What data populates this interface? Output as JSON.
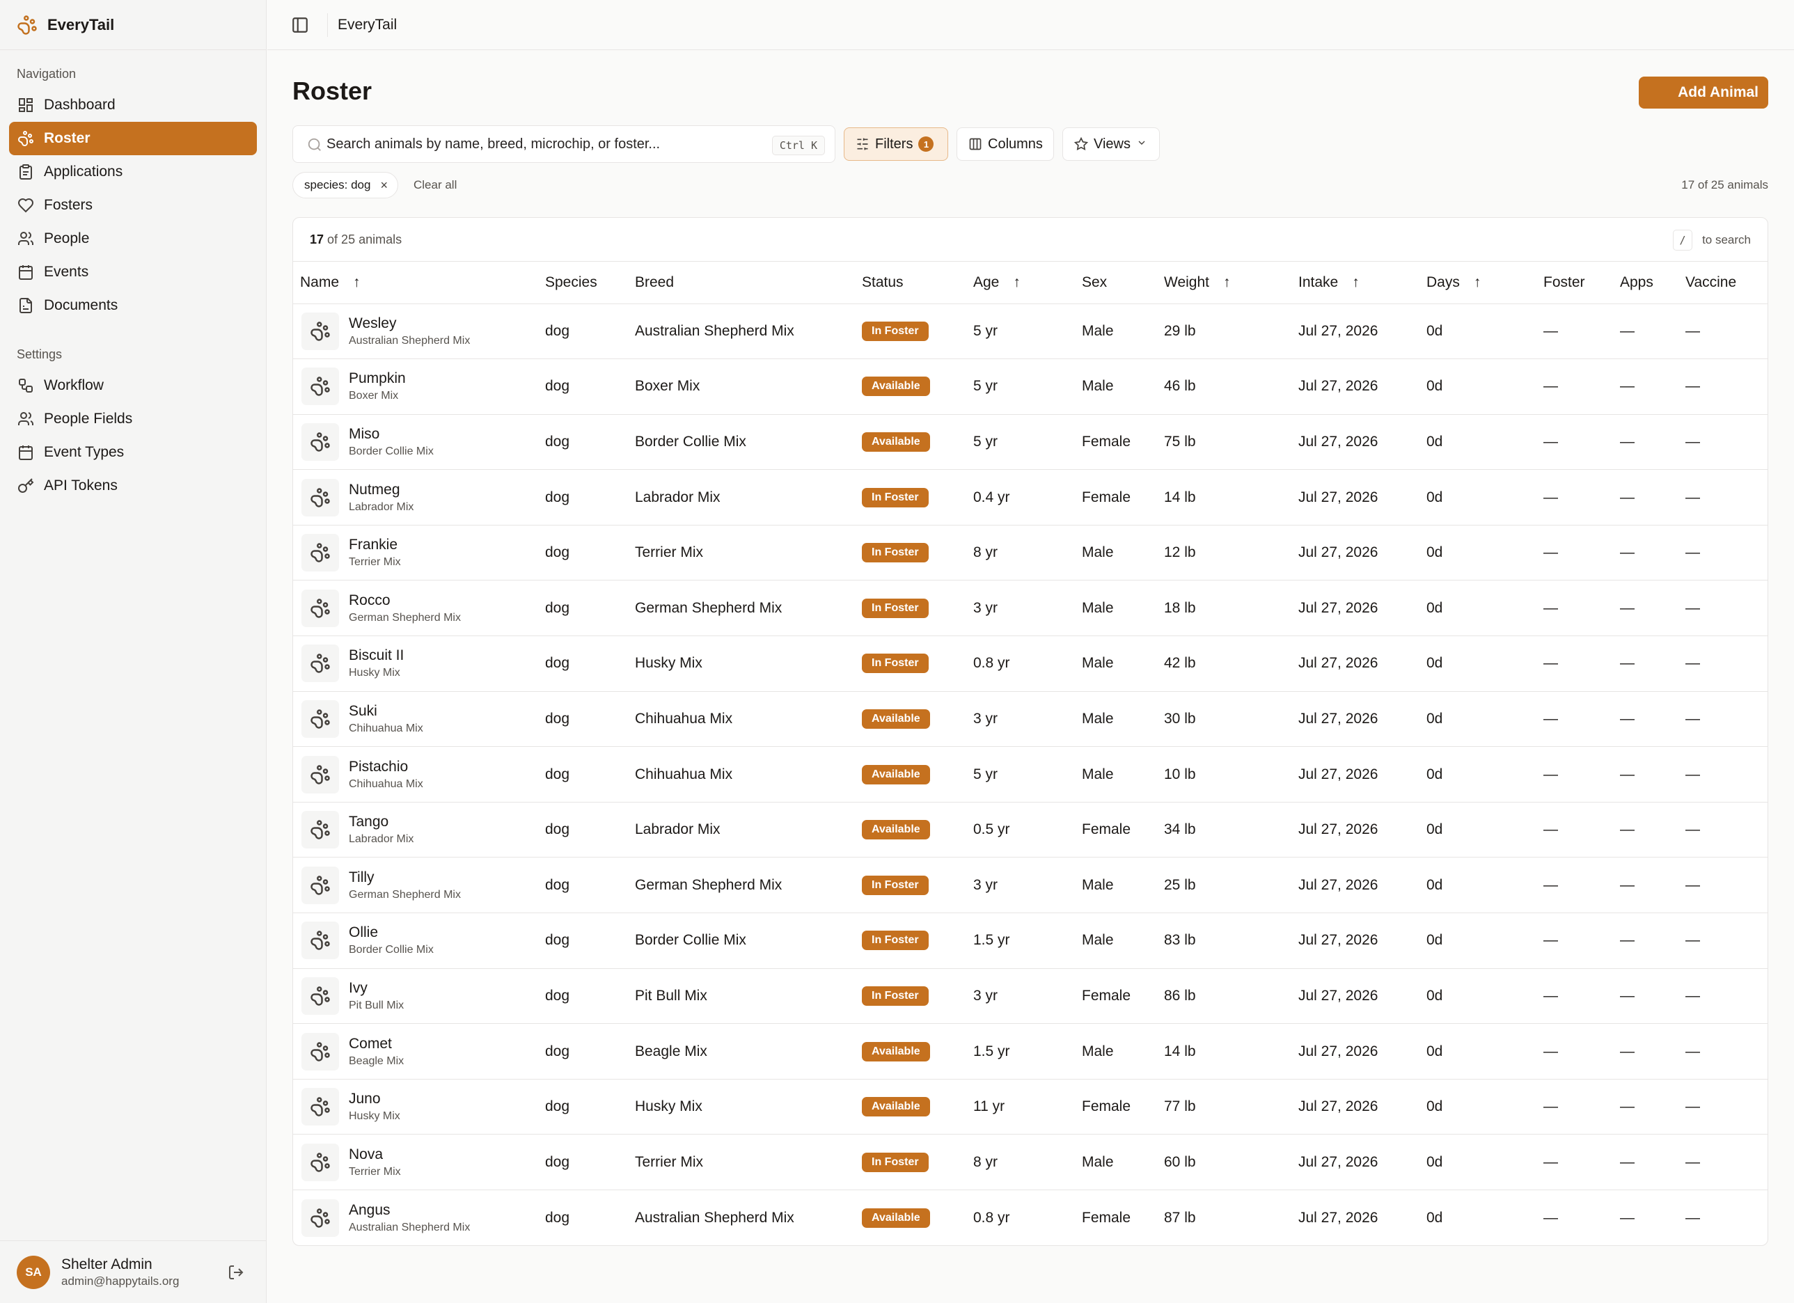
{
  "app": {
    "name": "EveryTail",
    "topbar_title": "EveryTail"
  },
  "sidebar": {
    "nav_title": "Navigation",
    "nav_items": [
      {
        "label": "Dashboard",
        "icon": "dashboard-icon"
      },
      {
        "label": "Roster",
        "icon": "paw-icon",
        "active": true
      },
      {
        "label": "Applications",
        "icon": "clipboard-icon"
      },
      {
        "label": "Fosters",
        "icon": "heart-hand-icon"
      },
      {
        "label": "People",
        "icon": "users-icon"
      },
      {
        "label": "Events",
        "icon": "calendar-icon"
      },
      {
        "label": "Documents",
        "icon": "document-icon"
      }
    ],
    "settings_title": "Settings",
    "settings_items": [
      {
        "label": "Workflow",
        "icon": "workflow-icon"
      },
      {
        "label": "People Fields",
        "icon": "users-icon"
      },
      {
        "label": "Event Types",
        "icon": "calendar-icon"
      },
      {
        "label": "API Tokens",
        "icon": "key-icon"
      }
    ],
    "user": {
      "initials": "SA",
      "name": "Shelter Admin",
      "email": "admin@happytails.org"
    }
  },
  "page": {
    "title": "Roster",
    "add_button": "Add Animal",
    "search_placeholder": "Search animals by name, breed, microchip, or foster...",
    "search_shortcut": "Ctrl K",
    "filters_label": "Filters",
    "filters_count": "1",
    "columns_label": "Columns",
    "views_label": "Views",
    "active_filter": "species: dog",
    "clear_all": "Clear all",
    "count_right": "17 of 25 animals",
    "card_count_bold": "17",
    "card_count_rest": "of 25 animals",
    "slash_key": "/",
    "slash_hint": "to search"
  },
  "table": {
    "headers": [
      "Name",
      "Species",
      "Breed",
      "Status",
      "Age",
      "Sex",
      "Weight",
      "Intake",
      "Days",
      "Foster",
      "Apps",
      "Vaccine"
    ],
    "rows": [
      {
        "name": "Wesley",
        "breed": "Australian Shepherd Mix",
        "species": "dog",
        "status": "In Foster",
        "age": "5 yr",
        "sex": "Male",
        "weight": "29 lb",
        "intake": "Jul 27, 2026",
        "days": "0d",
        "foster": "—",
        "apps": "—",
        "vaccine": "—"
      },
      {
        "name": "Pumpkin",
        "breed": "Boxer Mix",
        "species": "dog",
        "status": "Available",
        "age": "5 yr",
        "sex": "Male",
        "weight": "46 lb",
        "intake": "Jul 27, 2026",
        "days": "0d",
        "foster": "—",
        "apps": "—",
        "vaccine": "—"
      },
      {
        "name": "Miso",
        "breed": "Border Collie Mix",
        "species": "dog",
        "status": "Available",
        "age": "5 yr",
        "sex": "Female",
        "weight": "75 lb",
        "intake": "Jul 27, 2026",
        "days": "0d",
        "foster": "—",
        "apps": "—",
        "vaccine": "—"
      },
      {
        "name": "Nutmeg",
        "breed": "Labrador Mix",
        "species": "dog",
        "status": "In Foster",
        "age": "0.4 yr",
        "sex": "Female",
        "weight": "14 lb",
        "intake": "Jul 27, 2026",
        "days": "0d",
        "foster": "—",
        "apps": "—",
        "vaccine": "—"
      },
      {
        "name": "Frankie",
        "breed": "Terrier Mix",
        "species": "dog",
        "status": "In Foster",
        "age": "8 yr",
        "sex": "Male",
        "weight": "12 lb",
        "intake": "Jul 27, 2026",
        "days": "0d",
        "foster": "—",
        "apps": "—",
        "vaccine": "—"
      },
      {
        "name": "Rocco",
        "breed": "German Shepherd Mix",
        "species": "dog",
        "status": "In Foster",
        "age": "3 yr",
        "sex": "Male",
        "weight": "18 lb",
        "intake": "Jul 27, 2026",
        "days": "0d",
        "foster": "—",
        "apps": "—",
        "vaccine": "—"
      },
      {
        "name": "Biscuit II",
        "breed": "Husky Mix",
        "species": "dog",
        "status": "In Foster",
        "age": "0.8 yr",
        "sex": "Male",
        "weight": "42 lb",
        "intake": "Jul 27, 2026",
        "days": "0d",
        "foster": "—",
        "apps": "—",
        "vaccine": "—"
      },
      {
        "name": "Suki",
        "breed": "Chihuahua Mix",
        "species": "dog",
        "status": "Available",
        "age": "3 yr",
        "sex": "Male",
        "weight": "30 lb",
        "intake": "Jul 27, 2026",
        "days": "0d",
        "foster": "—",
        "apps": "—",
        "vaccine": "—"
      },
      {
        "name": "Pistachio",
        "breed": "Chihuahua Mix",
        "species": "dog",
        "status": "Available",
        "age": "5 yr",
        "sex": "Male",
        "weight": "10 lb",
        "intake": "Jul 27, 2026",
        "days": "0d",
        "foster": "—",
        "apps": "—",
        "vaccine": "—"
      },
      {
        "name": "Tango",
        "breed": "Labrador Mix",
        "species": "dog",
        "status": "Available",
        "age": "0.5 yr",
        "sex": "Female",
        "weight": "34 lb",
        "intake": "Jul 27, 2026",
        "days": "0d",
        "foster": "—",
        "apps": "—",
        "vaccine": "—"
      },
      {
        "name": "Tilly",
        "breed": "German Shepherd Mix",
        "species": "dog",
        "status": "In Foster",
        "age": "3 yr",
        "sex": "Male",
        "weight": "25 lb",
        "intake": "Jul 27, 2026",
        "days": "0d",
        "foster": "—",
        "apps": "—",
        "vaccine": "—"
      },
      {
        "name": "Ollie",
        "breed": "Border Collie Mix",
        "species": "dog",
        "status": "In Foster",
        "age": "1.5 yr",
        "sex": "Male",
        "weight": "83 lb",
        "intake": "Jul 27, 2026",
        "days": "0d",
        "foster": "—",
        "apps": "—",
        "vaccine": "—"
      },
      {
        "name": "Ivy",
        "breed": "Pit Bull Mix",
        "species": "dog",
        "status": "In Foster",
        "age": "3 yr",
        "sex": "Female",
        "weight": "86 lb",
        "intake": "Jul 27, 2026",
        "days": "0d",
        "foster": "—",
        "apps": "—",
        "vaccine": "—"
      },
      {
        "name": "Comet",
        "breed": "Beagle Mix",
        "species": "dog",
        "status": "Available",
        "age": "1.5 yr",
        "sex": "Male",
        "weight": "14 lb",
        "intake": "Jul 27, 2026",
        "days": "0d",
        "foster": "—",
        "apps": "—",
        "vaccine": "—"
      },
      {
        "name": "Juno",
        "breed": "Husky Mix",
        "species": "dog",
        "status": "Available",
        "age": "11 yr",
        "sex": "Female",
        "weight": "77 lb",
        "intake": "Jul 27, 2026",
        "days": "0d",
        "foster": "—",
        "apps": "—",
        "vaccine": "—"
      },
      {
        "name": "Nova",
        "breed": "Terrier Mix",
        "species": "dog",
        "status": "In Foster",
        "age": "8 yr",
        "sex": "Male",
        "weight": "60 lb",
        "intake": "Jul 27, 2026",
        "days": "0d",
        "foster": "—",
        "apps": "—",
        "vaccine": "—"
      },
      {
        "name": "Angus",
        "breed": "Australian Shepherd Mix",
        "species": "dog",
        "status": "Available",
        "age": "0.8 yr",
        "sex": "Female",
        "weight": "87 lb",
        "intake": "Jul 27, 2026",
        "days": "0d",
        "foster": "—",
        "apps": "—",
        "vaccine": "—"
      }
    ]
  },
  "colors": {
    "accent": "#c5711f",
    "accent_soft": "#fbeee0",
    "border": "#e7e5e4"
  }
}
